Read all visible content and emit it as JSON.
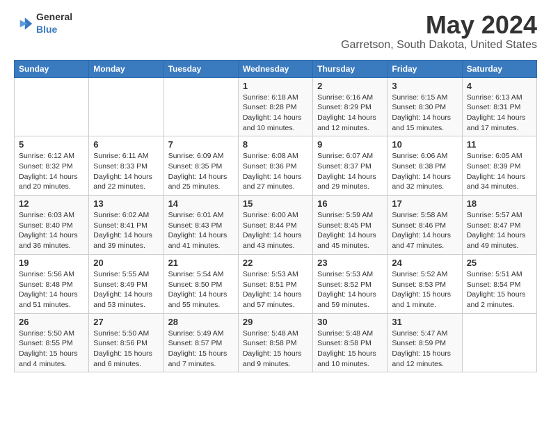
{
  "header": {
    "logo_general": "General",
    "logo_blue": "Blue",
    "title": "May 2024",
    "subtitle": "Garretson, South Dakota, United States"
  },
  "days_of_week": [
    "Sunday",
    "Monday",
    "Tuesday",
    "Wednesday",
    "Thursday",
    "Friday",
    "Saturday"
  ],
  "weeks": [
    [
      {
        "day": "",
        "info": ""
      },
      {
        "day": "",
        "info": ""
      },
      {
        "day": "",
        "info": ""
      },
      {
        "day": "1",
        "info": "Sunrise: 6:18 AM\nSunset: 8:28 PM\nDaylight: 14 hours\nand 10 minutes."
      },
      {
        "day": "2",
        "info": "Sunrise: 6:16 AM\nSunset: 8:29 PM\nDaylight: 14 hours\nand 12 minutes."
      },
      {
        "day": "3",
        "info": "Sunrise: 6:15 AM\nSunset: 8:30 PM\nDaylight: 14 hours\nand 15 minutes."
      },
      {
        "day": "4",
        "info": "Sunrise: 6:13 AM\nSunset: 8:31 PM\nDaylight: 14 hours\nand 17 minutes."
      }
    ],
    [
      {
        "day": "5",
        "info": "Sunrise: 6:12 AM\nSunset: 8:32 PM\nDaylight: 14 hours\nand 20 minutes."
      },
      {
        "day": "6",
        "info": "Sunrise: 6:11 AM\nSunset: 8:33 PM\nDaylight: 14 hours\nand 22 minutes."
      },
      {
        "day": "7",
        "info": "Sunrise: 6:09 AM\nSunset: 8:35 PM\nDaylight: 14 hours\nand 25 minutes."
      },
      {
        "day": "8",
        "info": "Sunrise: 6:08 AM\nSunset: 8:36 PM\nDaylight: 14 hours\nand 27 minutes."
      },
      {
        "day": "9",
        "info": "Sunrise: 6:07 AM\nSunset: 8:37 PM\nDaylight: 14 hours\nand 29 minutes."
      },
      {
        "day": "10",
        "info": "Sunrise: 6:06 AM\nSunset: 8:38 PM\nDaylight: 14 hours\nand 32 minutes."
      },
      {
        "day": "11",
        "info": "Sunrise: 6:05 AM\nSunset: 8:39 PM\nDaylight: 14 hours\nand 34 minutes."
      }
    ],
    [
      {
        "day": "12",
        "info": "Sunrise: 6:03 AM\nSunset: 8:40 PM\nDaylight: 14 hours\nand 36 minutes."
      },
      {
        "day": "13",
        "info": "Sunrise: 6:02 AM\nSunset: 8:41 PM\nDaylight: 14 hours\nand 39 minutes."
      },
      {
        "day": "14",
        "info": "Sunrise: 6:01 AM\nSunset: 8:43 PM\nDaylight: 14 hours\nand 41 minutes."
      },
      {
        "day": "15",
        "info": "Sunrise: 6:00 AM\nSunset: 8:44 PM\nDaylight: 14 hours\nand 43 minutes."
      },
      {
        "day": "16",
        "info": "Sunrise: 5:59 AM\nSunset: 8:45 PM\nDaylight: 14 hours\nand 45 minutes."
      },
      {
        "day": "17",
        "info": "Sunrise: 5:58 AM\nSunset: 8:46 PM\nDaylight: 14 hours\nand 47 minutes."
      },
      {
        "day": "18",
        "info": "Sunrise: 5:57 AM\nSunset: 8:47 PM\nDaylight: 14 hours\nand 49 minutes."
      }
    ],
    [
      {
        "day": "19",
        "info": "Sunrise: 5:56 AM\nSunset: 8:48 PM\nDaylight: 14 hours\nand 51 minutes."
      },
      {
        "day": "20",
        "info": "Sunrise: 5:55 AM\nSunset: 8:49 PM\nDaylight: 14 hours\nand 53 minutes."
      },
      {
        "day": "21",
        "info": "Sunrise: 5:54 AM\nSunset: 8:50 PM\nDaylight: 14 hours\nand 55 minutes."
      },
      {
        "day": "22",
        "info": "Sunrise: 5:53 AM\nSunset: 8:51 PM\nDaylight: 14 hours\nand 57 minutes."
      },
      {
        "day": "23",
        "info": "Sunrise: 5:53 AM\nSunset: 8:52 PM\nDaylight: 14 hours\nand 59 minutes."
      },
      {
        "day": "24",
        "info": "Sunrise: 5:52 AM\nSunset: 8:53 PM\nDaylight: 15 hours\nand 1 minute."
      },
      {
        "day": "25",
        "info": "Sunrise: 5:51 AM\nSunset: 8:54 PM\nDaylight: 15 hours\nand 2 minutes."
      }
    ],
    [
      {
        "day": "26",
        "info": "Sunrise: 5:50 AM\nSunset: 8:55 PM\nDaylight: 15 hours\nand 4 minutes."
      },
      {
        "day": "27",
        "info": "Sunrise: 5:50 AM\nSunset: 8:56 PM\nDaylight: 15 hours\nand 6 minutes."
      },
      {
        "day": "28",
        "info": "Sunrise: 5:49 AM\nSunset: 8:57 PM\nDaylight: 15 hours\nand 7 minutes."
      },
      {
        "day": "29",
        "info": "Sunrise: 5:48 AM\nSunset: 8:58 PM\nDaylight: 15 hours\nand 9 minutes."
      },
      {
        "day": "30",
        "info": "Sunrise: 5:48 AM\nSunset: 8:58 PM\nDaylight: 15 hours\nand 10 minutes."
      },
      {
        "day": "31",
        "info": "Sunrise: 5:47 AM\nSunset: 8:59 PM\nDaylight: 15 hours\nand 12 minutes."
      },
      {
        "day": "",
        "info": ""
      }
    ]
  ]
}
